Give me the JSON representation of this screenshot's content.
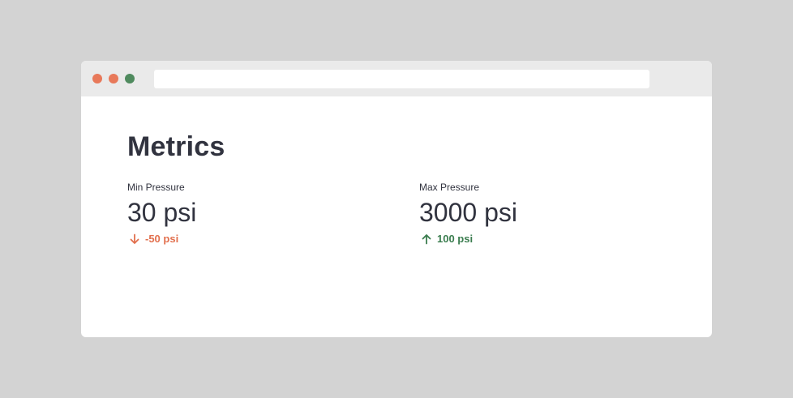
{
  "window": {
    "dots": {
      "close_color": "#e8795a",
      "minimize_color": "#e8795a",
      "maximize_color": "#4f8a5e"
    },
    "address_bar": {
      "value": ""
    }
  },
  "page": {
    "title": "Metrics"
  },
  "metrics": [
    {
      "label": "Min Pressure",
      "value": "30 psi",
      "delta": "-50 psi",
      "direction": "down",
      "icon": "arrow-down-icon",
      "color": "#e2704e"
    },
    {
      "label": "Max Pressure",
      "value": "3000 psi",
      "delta": "100 psi",
      "direction": "up",
      "icon": "arrow-up-icon",
      "color": "#3b7d4f"
    }
  ]
}
